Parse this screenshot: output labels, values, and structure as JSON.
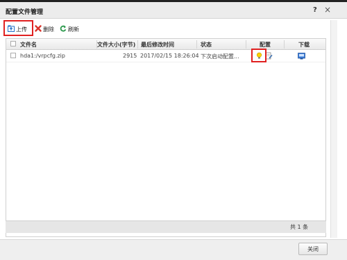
{
  "dialog": {
    "title": "配置文件管理",
    "help_label": "?",
    "close_label": "×"
  },
  "toolbar": {
    "upload_label": "上传",
    "delete_label": "删除",
    "refresh_label": "刷新",
    "colors": {
      "highlight": "#e02020",
      "upload": "#1f6fc7",
      "delete": "#d9342b",
      "refresh": "#2e9a4e"
    }
  },
  "table": {
    "columns": [
      "文件名",
      "文件大小(字节)",
      "最后修改时间",
      "状态",
      "配置",
      "下载"
    ],
    "rows": [
      {
        "name": "hda1:/vrpcfg.zip",
        "size": "2915",
        "modified": "2017/02/15 18:26:04",
        "status": "下次启动配置..."
      }
    ]
  },
  "footer": {
    "total": "共 1 条"
  },
  "buttons": {
    "close": "关闭"
  }
}
